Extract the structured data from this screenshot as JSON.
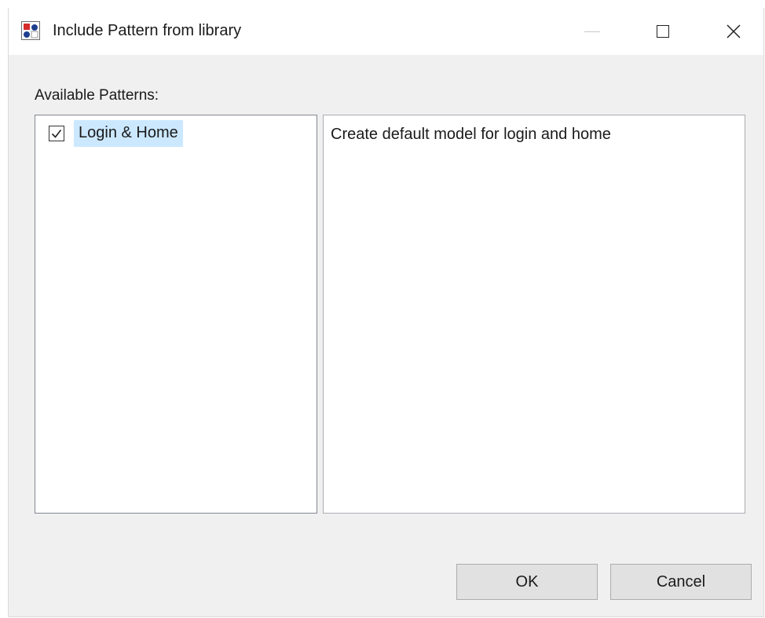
{
  "window": {
    "title": "Include Pattern from library",
    "icon": "app-pattern-icon",
    "controls": {
      "minimize": "minimize-icon",
      "maximize": "maximize-icon",
      "close": "close-icon"
    }
  },
  "available_patterns": {
    "label": "Available Patterns:",
    "items": [
      {
        "label": "Login & Home",
        "checked": true,
        "selected": true
      }
    ]
  },
  "description": {
    "text": "Create default model for login and home"
  },
  "buttons": {
    "ok_label": "OK",
    "cancel_label": "Cancel"
  },
  "colors": {
    "selection": "#cce8ff",
    "dialog_background": "#f0f0f0",
    "titlebar_background": "#ffffff",
    "button_background": "#e1e1e1"
  }
}
